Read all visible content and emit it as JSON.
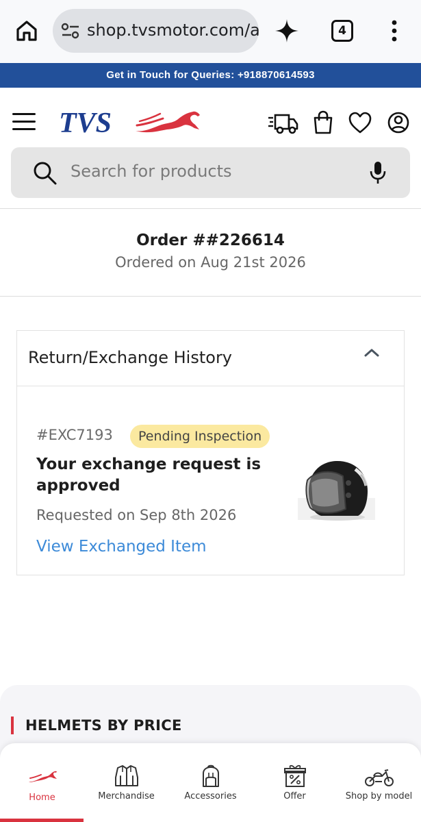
{
  "browser": {
    "url": "shop.tvsmotor.com/app",
    "tab_count": "4"
  },
  "banner": {
    "text": "Get in Touch for Queries: +918870614593"
  },
  "header": {
    "logo_text": "TVS"
  },
  "search": {
    "placeholder": "Search for products"
  },
  "order": {
    "title": "Order ##226614",
    "date": "Ordered on Aug 21st 2026"
  },
  "history": {
    "title": "Return/Exchange History",
    "items": [
      {
        "id": "#EXC7193",
        "status": "Pending Inspection",
        "message": "Your exchange request is approved",
        "requested": "Requested on Sep 8th 2026",
        "link": "View Exchanged Item"
      }
    ]
  },
  "section": {
    "title": "HELMETS BY PRICE"
  },
  "bottom_nav": {
    "items": [
      {
        "label": "Home",
        "icon": "horse-icon",
        "active": true
      },
      {
        "label": "Merchandise",
        "icon": "jacket-icon",
        "active": false
      },
      {
        "label": "Accessories",
        "icon": "backpack-icon",
        "active": false
      },
      {
        "label": "Offer",
        "icon": "gift-percent-icon",
        "active": false
      },
      {
        "label": "Shop by model",
        "icon": "motorcycle-icon",
        "active": false
      }
    ]
  },
  "colors": {
    "brand_blue": "#22509a",
    "brand_red": "#d9333f",
    "link_blue": "#3c8ad8",
    "badge_yellow": "#fbe9a0"
  }
}
